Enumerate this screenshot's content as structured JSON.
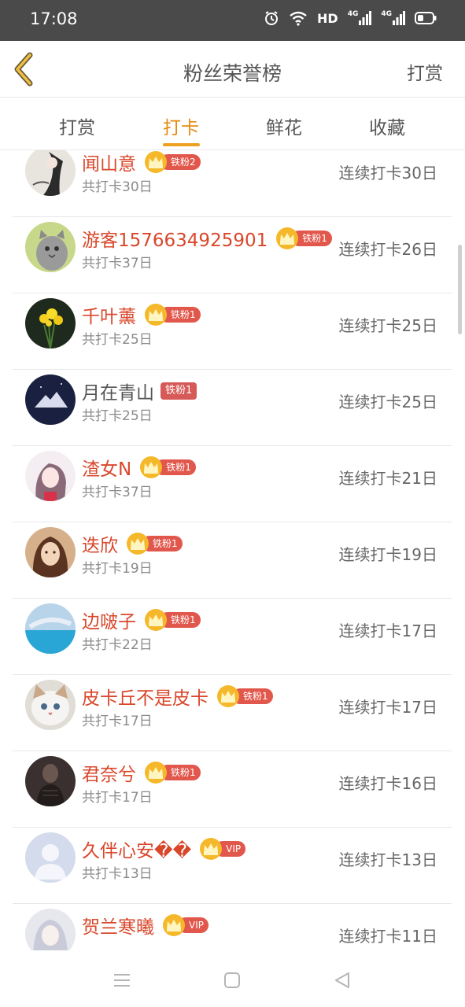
{
  "status_bar": {
    "time": "17:08",
    "hd_label": "HD",
    "net1": "4G",
    "net2": "4G",
    "icons": [
      "alarm-icon",
      "wifi-icon",
      "signal-icon",
      "battery-icon"
    ]
  },
  "header": {
    "title": "粉丝荣誉榜",
    "action": "打赏",
    "back_icon": "chevron-left-icon"
  },
  "tabs": [
    {
      "label": "打赏",
      "active": false
    },
    {
      "label": "打卡",
      "active": true
    },
    {
      "label": "鲜花",
      "active": false
    },
    {
      "label": "收藏",
      "active": false
    }
  ],
  "colors": {
    "accent": "#f0a020",
    "name_red": "#d9472b",
    "badge_red": "#e2574c",
    "status_bar": "#4a4a4a"
  },
  "users": [
    {
      "name": "闻山意",
      "badge": "铁粉2",
      "crown": true,
      "total": "共打卡30日",
      "streak": "连续打卡30日",
      "avatar": "ink-painting-avatar"
    },
    {
      "name": "游客1576634925901",
      "badge": "铁粉1",
      "crown": true,
      "total": "共打卡37日",
      "streak": "连续打卡26日",
      "avatar": "cat-avatar"
    },
    {
      "name": "千叶薰",
      "badge": "铁粉1",
      "crown": true,
      "total": "共打卡25日",
      "streak": "连续打卡25日",
      "avatar": "flowers-avatar"
    },
    {
      "name": "月在青山",
      "badge": "铁粉1",
      "crown": false,
      "total": "共打卡25日",
      "streak": "连续打卡25日",
      "avatar": "mountain-avatar"
    },
    {
      "name": "渣女N",
      "badge": "铁粉1",
      "crown": true,
      "total": "共打卡37日",
      "streak": "连续打卡21日",
      "avatar": "anime-girl-avatar"
    },
    {
      "name": "迭欣",
      "badge": "铁粉1",
      "crown": true,
      "total": "共打卡19日",
      "streak": "连续打卡19日",
      "avatar": "portrait-avatar"
    },
    {
      "name": "边啵子",
      "badge": "铁粉1",
      "crown": true,
      "total": "共打卡22日",
      "streak": "连续打卡17日",
      "avatar": "sky-avatar"
    },
    {
      "name": "皮卡丘不是皮卡",
      "badge": "铁粉1",
      "crown": true,
      "total": "共打卡17日",
      "streak": "连续打卡17日",
      "avatar": "kitten-avatar"
    },
    {
      "name": "君奈兮",
      "badge": "铁粉1",
      "crown": true,
      "total": "共打卡17日",
      "streak": "连续打卡16日",
      "avatar": "dark-photo-avatar"
    },
    {
      "name": "久伴心安��",
      "badge": "VIP",
      "crown": true,
      "total": "共打卡13日",
      "streak": "连续打卡13日",
      "avatar": "default-avatar"
    },
    {
      "name": "贺兰寒曦",
      "badge": "VIP",
      "crown": true,
      "total": "",
      "streak": "连续打卡11日",
      "avatar": "illustration-avatar"
    }
  ],
  "nav_bar": {
    "items": [
      "menu-icon",
      "home-square-icon",
      "back-triangle-icon"
    ]
  }
}
